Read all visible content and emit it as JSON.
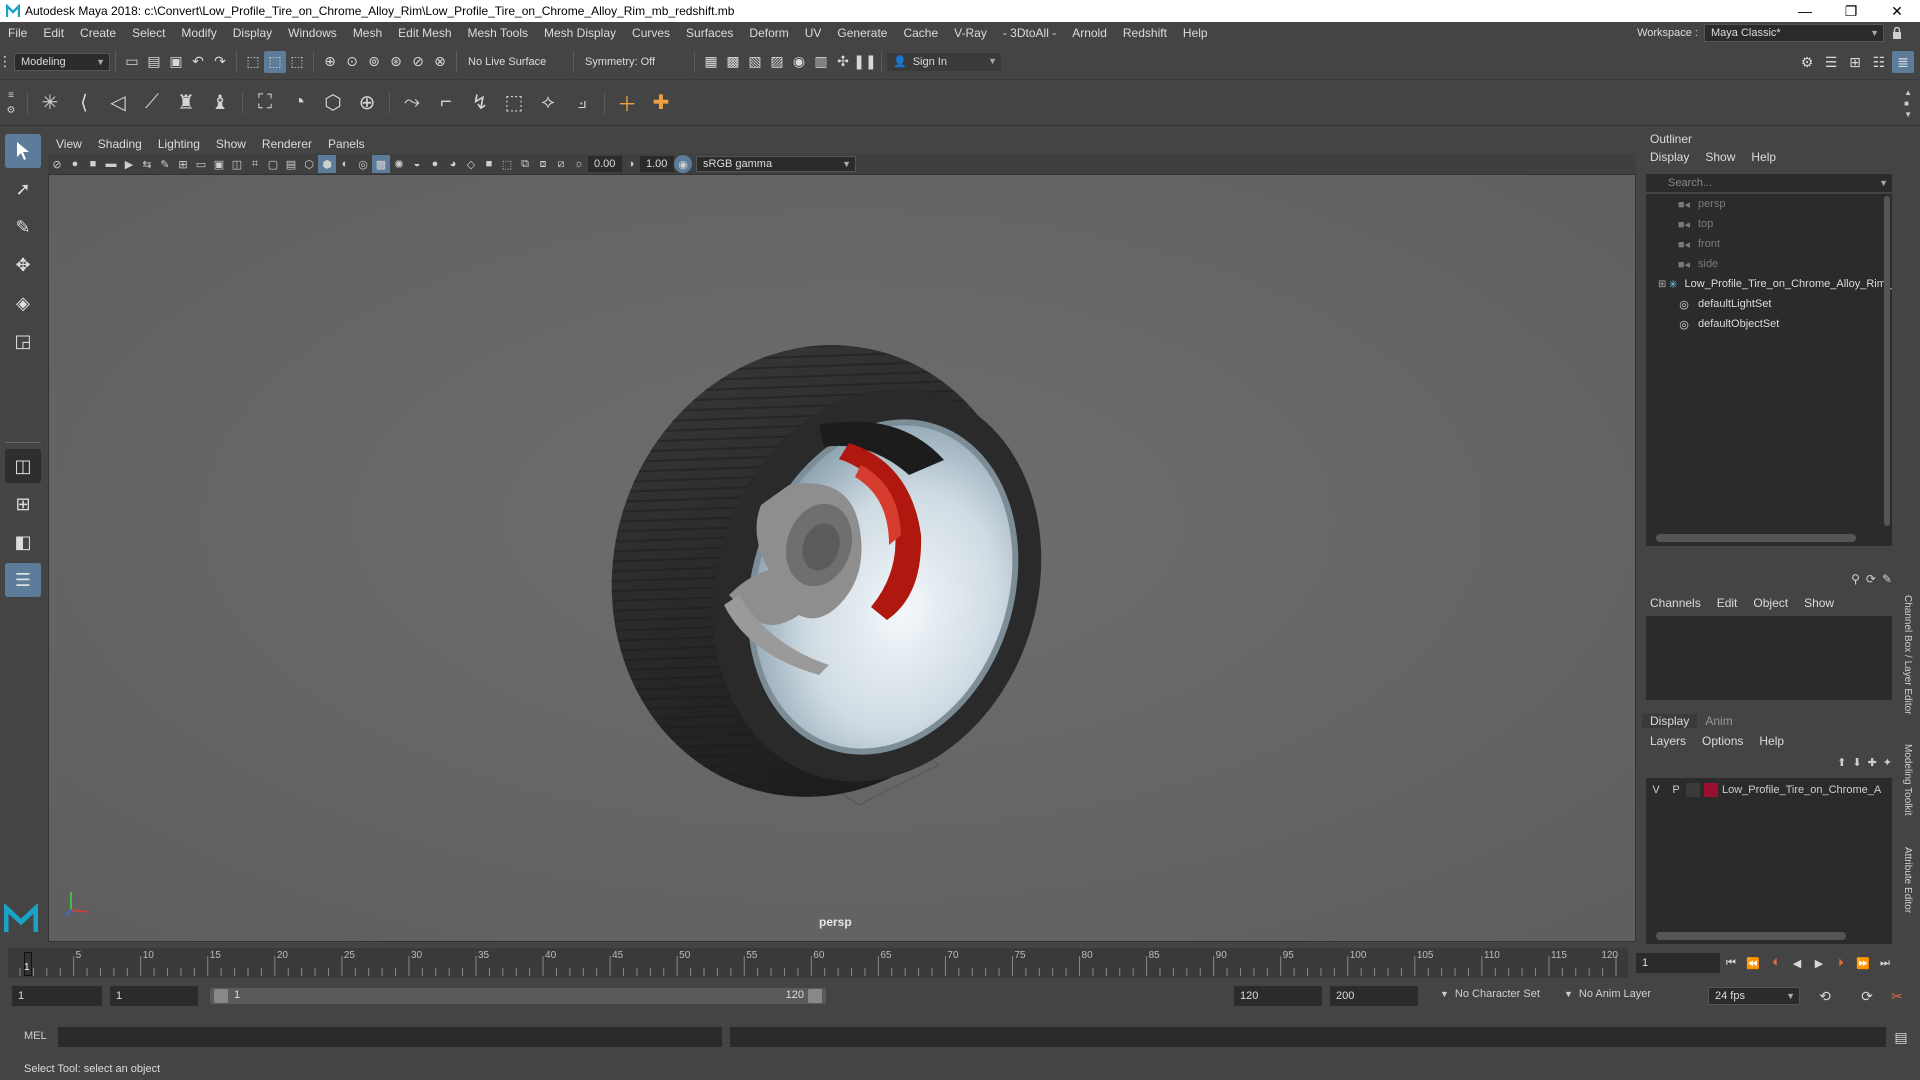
{
  "window": {
    "title": "Autodesk Maya 2018: c:\\Convert\\Low_Profile_Tire_on_Chrome_Alloy_Rim\\Low_Profile_Tire_on_Chrome_Alloy_Rim_mb_redshift.mb",
    "minimize": "—",
    "maximize": "❐",
    "close": "✕"
  },
  "menubar": {
    "items": [
      "File",
      "Edit",
      "Create",
      "Select",
      "Modify",
      "Display",
      "Windows",
      "Mesh",
      "Edit Mesh",
      "Mesh Tools",
      "Mesh Display",
      "Curves",
      "Surfaces",
      "Deform",
      "UV",
      "Generate",
      "Cache",
      "V-Ray",
      "- 3DtoAll -",
      "Arnold",
      "Redshift",
      "Help"
    ],
    "workspace_label": "Workspace :",
    "workspace_value": "Maya Classic*"
  },
  "statusline": {
    "mode": "Modeling",
    "live_surface": "No Live Surface",
    "symmetry": "Symmetry: Off",
    "sign_in": "Sign In"
  },
  "viewport": {
    "menu": [
      "View",
      "Shading",
      "Lighting",
      "Show",
      "Renderer",
      "Panels"
    ],
    "exposure": "0.00",
    "gamma": "1.00",
    "color_space": "sRGB gamma",
    "camera_label": "persp"
  },
  "outliner": {
    "title": "Outliner",
    "menu": [
      "Display",
      "Show",
      "Help"
    ],
    "search_placeholder": "Search...",
    "items": [
      {
        "label": "persp",
        "icon": "camera-icon",
        "dim": true
      },
      {
        "label": "top",
        "icon": "camera-icon",
        "dim": true
      },
      {
        "label": "front",
        "icon": "camera-icon",
        "dim": true
      },
      {
        "label": "side",
        "icon": "camera-icon",
        "dim": true
      },
      {
        "label": "Low_Profile_Tire_on_Chrome_Alloy_Rim_",
        "icon": "group-icon",
        "dim": false
      },
      {
        "label": "defaultLightSet",
        "icon": "set-icon",
        "dim": false
      },
      {
        "label": "defaultObjectSet",
        "icon": "set-icon",
        "dim": false
      }
    ]
  },
  "channelbox": {
    "menu": [
      "Channels",
      "Edit",
      "Object",
      "Show"
    ]
  },
  "layereditor": {
    "tabs": [
      "Display",
      "Anim"
    ],
    "menu": [
      "Layers",
      "Options",
      "Help"
    ],
    "layer": {
      "v": "V",
      "p": "P",
      "name": "Low_Profile_Tire_on_Chrome_A",
      "color": "#9a1030"
    }
  },
  "sidetabs": [
    "Channel Box / Layer Editor",
    "Modeling Toolkit",
    "Attribute Editor"
  ],
  "timeslider": {
    "ticks": [
      "5",
      "10",
      "15",
      "20",
      "25",
      "30",
      "35",
      "40",
      "45",
      "50",
      "55",
      "60",
      "65",
      "70",
      "75",
      "80",
      "85",
      "90",
      "95",
      "100",
      "105",
      "110",
      "115",
      "120"
    ],
    "current_frame_marker": "1",
    "current_frame": "1"
  },
  "rangebar": {
    "start": "1",
    "playback_start": "1",
    "range_start_label": "1",
    "range_end_label": "120",
    "playback_end": "120",
    "end": "200",
    "character_set": "No Character Set",
    "anim_layer": "No Anim Layer",
    "fps": "24 fps"
  },
  "cmdline": {
    "label": "MEL"
  },
  "helpline": {
    "text": "Select Tool: select an object"
  }
}
